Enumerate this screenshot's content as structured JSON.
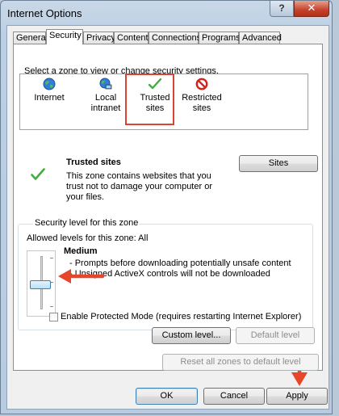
{
  "window": {
    "title": "Internet Options",
    "help_label": "?",
    "close_label": "✕"
  },
  "tabs": [
    {
      "label": "General",
      "active": false
    },
    {
      "label": "Security",
      "active": true
    },
    {
      "label": "Privacy",
      "active": false
    },
    {
      "label": "Content",
      "active": false
    },
    {
      "label": "Connections",
      "active": false
    },
    {
      "label": "Programs",
      "active": false
    },
    {
      "label": "Advanced",
      "active": false
    }
  ],
  "security": {
    "select_zone_prompt": "Select a zone to view or change security settings.",
    "zones": [
      {
        "label_line1": "Internet",
        "label_line2": "",
        "icon": "globe-icon",
        "selected": false
      },
      {
        "label_line1": "Local",
        "label_line2": "intranet",
        "icon": "computer-globe-icon",
        "selected": false
      },
      {
        "label_line1": "Trusted",
        "label_line2": "sites",
        "icon": "checkmark-icon",
        "selected": true
      },
      {
        "label_line1": "Restricted",
        "label_line2": "sites",
        "icon": "no-entry-icon",
        "selected": false
      }
    ],
    "zone_title": "Trusted sites",
    "zone_description_lines": [
      "This zone contains websites that you",
      "trust not to damage your computer or",
      "your files."
    ],
    "sites_button_label": "Sites",
    "level_group_label": "Security level for this zone",
    "allowed_levels": "Allowed levels for this zone: All",
    "level_name": "Medium",
    "level_bullets": [
      "- Prompts before downloading potentially unsafe content",
      "- Unsigned ActiveX controls will not be downloaded"
    ],
    "slider_level": 0.5,
    "protected_mode_label": "Enable Protected Mode (requires restarting Internet Explorer)",
    "protected_mode_checked": false,
    "custom_level_label": "Custom level...",
    "default_level_label": "Default level",
    "reset_all_label": "Reset all zones to default level"
  },
  "footer": {
    "ok_label": "OK",
    "cancel_label": "Cancel",
    "apply_label": "Apply"
  },
  "colors": {
    "highlight_box": "#d9432f",
    "arrow": "#e8462a",
    "checkmark": "#3fae3f",
    "restricted": "#d8211b",
    "slider_thumb": "#b8e0f7"
  }
}
